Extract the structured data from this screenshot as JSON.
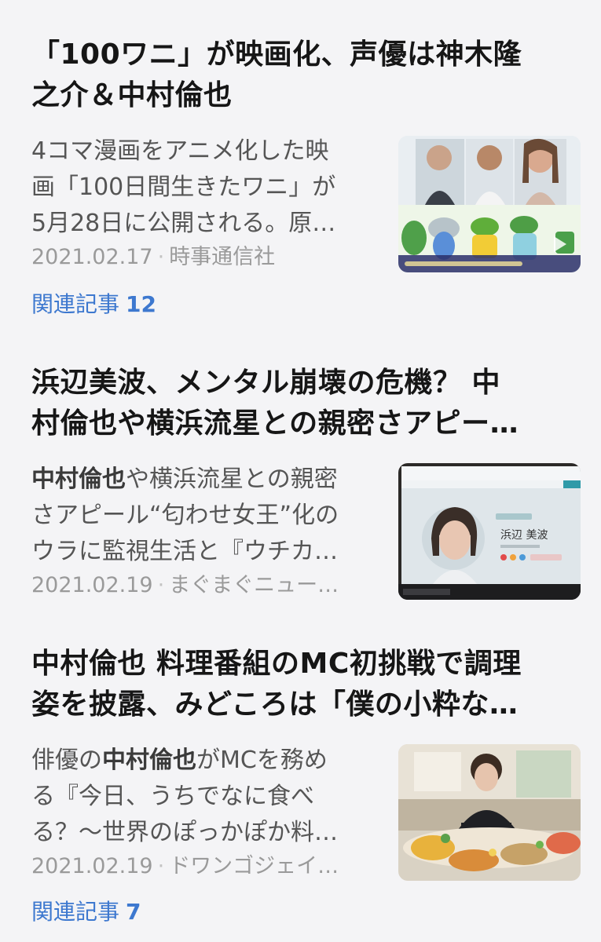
{
  "articles": [
    {
      "headline_lines": [
        "「100ワニ」が映画化、声優は神木隆",
        "之介＆中村倫也"
      ],
      "summary_lines": [
        {
          "pre": "4コマ漫画をアニメ化した映",
          "bold": "",
          "post": ""
        },
        {
          "pre": "画「100日間生きたワニ」が",
          "bold": "",
          "post": ""
        },
        {
          "pre": "5月28日に公開される。原…",
          "bold": "",
          "post": ""
        }
      ],
      "date": "2021.02.17",
      "source": "時事通信社",
      "related_label": "関連記事",
      "related_count": "12",
      "thumbnail": "movie-cast-and-crocodile-image"
    },
    {
      "headline_lines": [
        "浜辺美波、メンタル崩壊の危機？ 中",
        "村倫也や横浜流星との親密さアピー…"
      ],
      "summary_lines": [
        {
          "pre": "",
          "bold": "中村倫也",
          "post": "や横浜流星との親密"
        },
        {
          "pre": "さアピール“匂わせ女王”化の",
          "bold": "",
          "post": ""
        },
        {
          "pre": "ウラに監視生活と『ウチカ…",
          "bold": "",
          "post": ""
        }
      ],
      "date": "2021.02.19",
      "source": "まぐまぐニュー…",
      "thumbnail": "actress-profile-webpage-image",
      "thumb_text": "浜辺 美波"
    },
    {
      "headline_lines": [
        "中村倫也 料理番組のMC初挑戦で調理",
        "姿を披露、みどころは「僕の小粋な…"
      ],
      "summary_lines": [
        {
          "pre": "俳優の",
          "bold": "中村倫也",
          "post": "がMCを務め"
        },
        {
          "pre": "る『今日、うちでなに食べ",
          "bold": "",
          "post": ""
        },
        {
          "pre": "る？〜世界のぽっかぽか料…",
          "bold": "",
          "post": ""
        }
      ],
      "date": "2021.02.19",
      "source": "ドワンゴジェイ…",
      "related_label": "関連記事",
      "related_count": "7",
      "thumbnail": "cooking-show-host-image"
    }
  ],
  "colors": {
    "background": "#f4f4f6",
    "headline": "#161616",
    "summary": "#555555",
    "meta": "#9a9a9a",
    "related_link": "#3d78cf"
  }
}
